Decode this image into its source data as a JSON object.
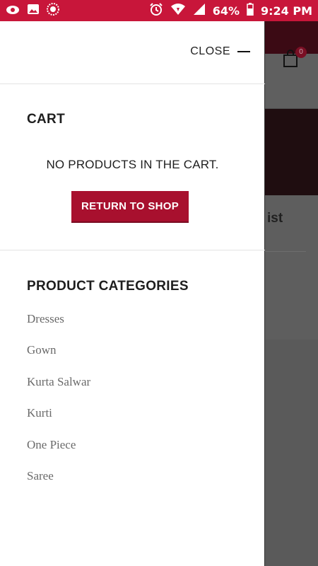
{
  "status_bar": {
    "battery": "64%",
    "time": "9:24 PM",
    "icons": [
      "eye-icon",
      "image-icon",
      "app-icon",
      "alarm-icon",
      "wifi-icon",
      "signal-icon",
      "battery-icon"
    ]
  },
  "background_page": {
    "cart_badge_count": "0",
    "partial_text": "ist"
  },
  "drawer": {
    "close_label": "CLOSE",
    "cart_title": "CART",
    "empty_message": "NO PRODUCTS IN THE CART.",
    "return_button": "RETURN TO SHOP",
    "categories_title": "PRODUCT CATEGORIES",
    "categories": [
      {
        "label": "Dresses"
      },
      {
        "label": "Gown"
      },
      {
        "label": "Kurta Salwar"
      },
      {
        "label": "Kurti"
      },
      {
        "label": "One Piece"
      },
      {
        "label": "Saree"
      }
    ]
  },
  "colors": {
    "status_bar": "#c8163a",
    "accent": "#a8102e",
    "overlay": "#5a5a5a"
  }
}
